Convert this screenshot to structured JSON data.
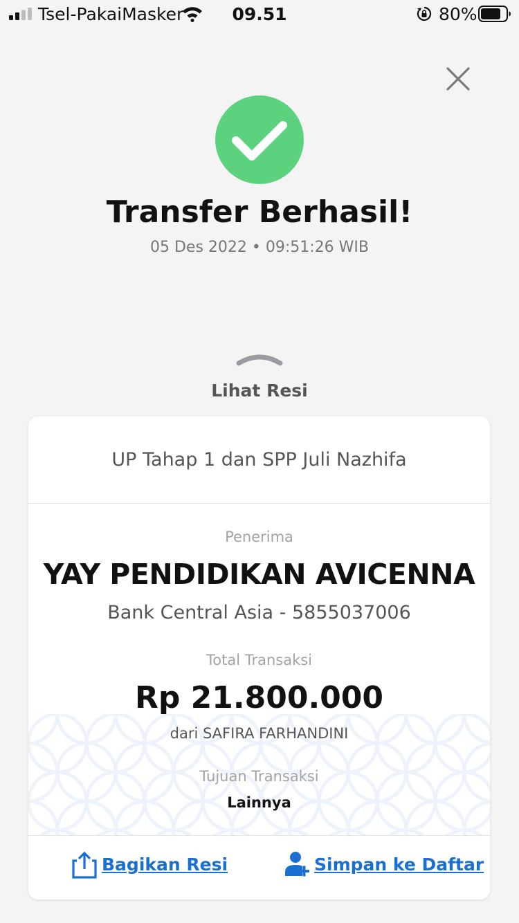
{
  "status_bar": {
    "carrier": "Tsel-PakaiMasker",
    "time": "09.51",
    "battery_percent": "80%",
    "battery_level": 0.8
  },
  "result": {
    "title": "Transfer Berhasil!",
    "datetime": "05 Des 2022 • 09:51:26 WIB"
  },
  "receipt_toggle": {
    "label": "Lihat Resi"
  },
  "receipt": {
    "note": "UP Tahap 1 dan SPP Juli Nazhifa",
    "recipient_label": "Penerima",
    "recipient_name": "YAY PENDIDIKAN AVICENNA",
    "recipient_bank": "Bank Central Asia - 5855037006",
    "total_label": "Total Transaksi",
    "total_amount": "Rp 21.800.000",
    "from": "dari SAFIRA FARHANDINI",
    "purpose_label": "Tujuan Transaksi",
    "purpose_value": "Lainnya"
  },
  "actions": {
    "share_label": "Bagikan Resi",
    "save_label": "Simpan ke Daftar"
  },
  "colors": {
    "success": "#5cd27f",
    "link": "#1a6fd0",
    "background": "#f4f4f4"
  },
  "icons": {
    "close": "close-icon",
    "success": "check-circle-icon",
    "toggle": "chevron-up-icon",
    "share": "share-icon",
    "save": "add-user-icon"
  }
}
